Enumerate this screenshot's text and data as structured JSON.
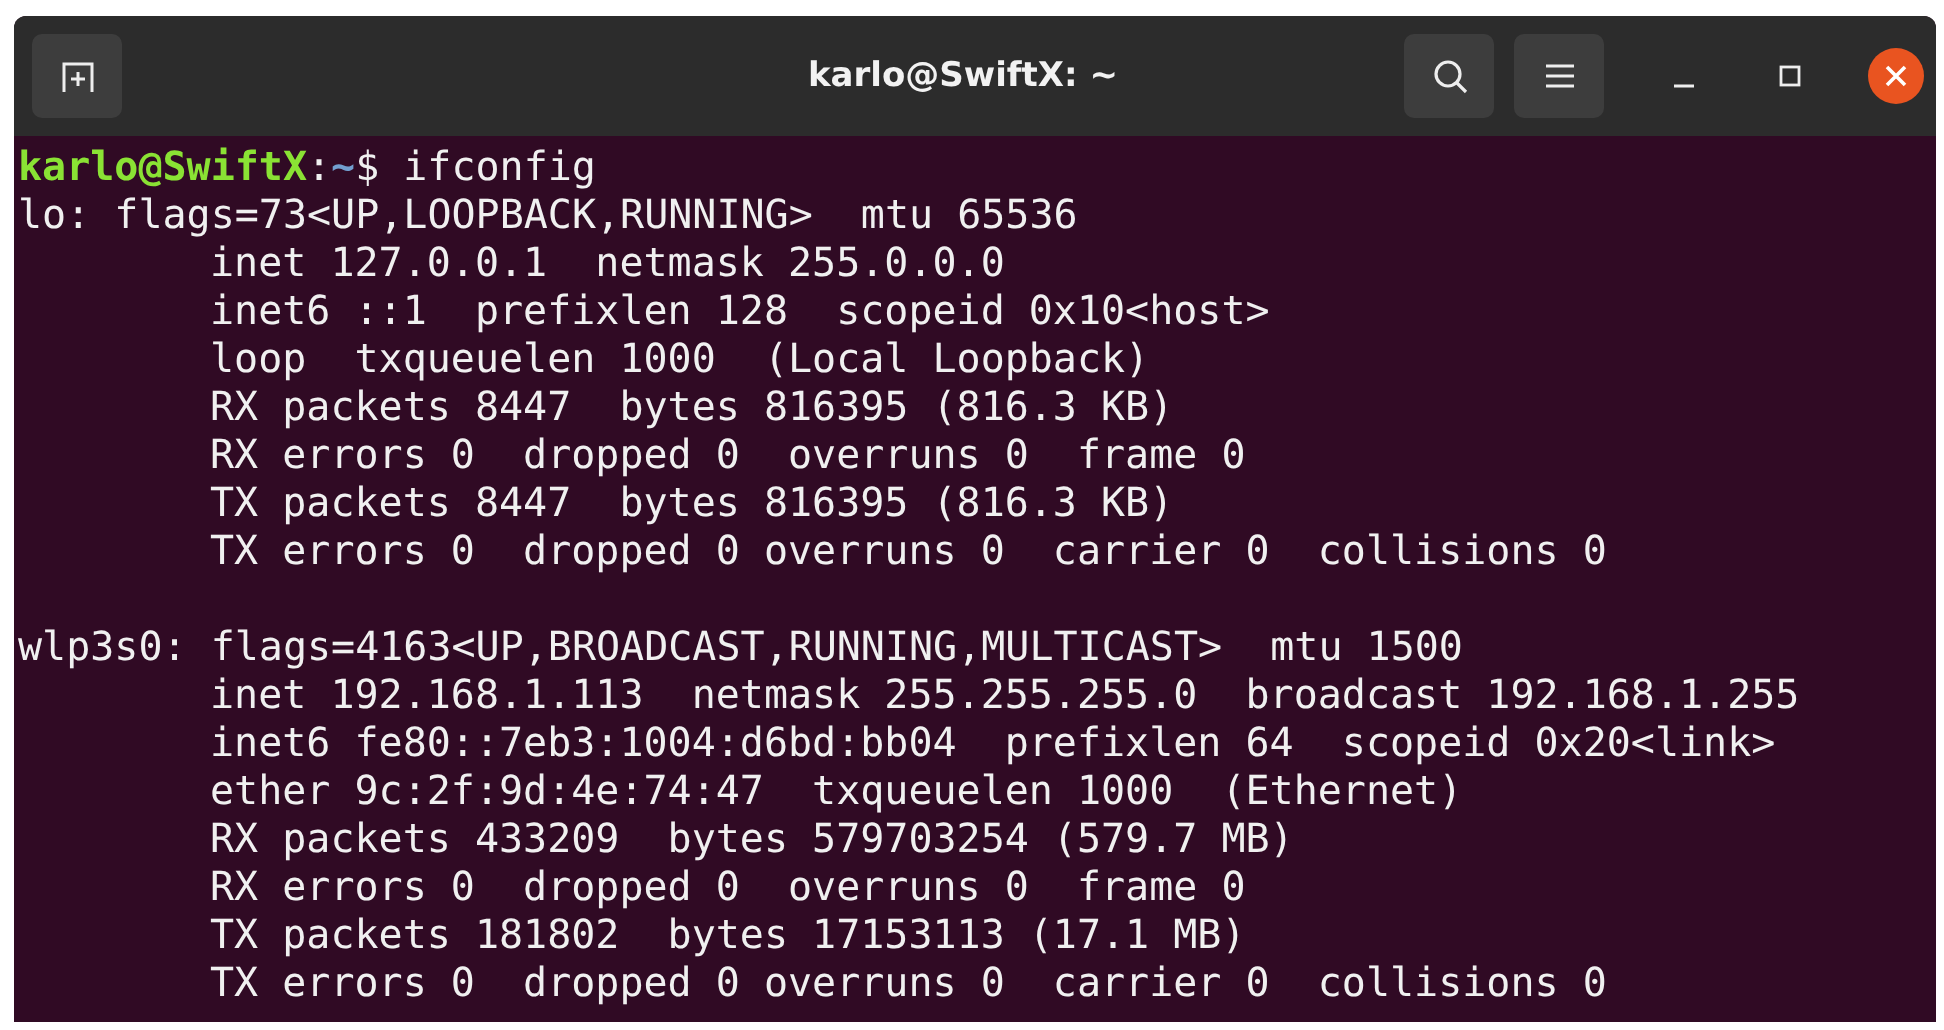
{
  "window": {
    "title": "karlo@SwiftX: ~"
  },
  "prompt": {
    "user_host": "karlo@SwiftX",
    "separator": ":",
    "path": "~",
    "symbol": "$",
    "command": "ifconfig"
  },
  "interfaces": [
    {
      "header": "lo: flags=73<UP,LOOPBACK,RUNNING>  mtu 65536",
      "lines": [
        "inet 127.0.0.1  netmask 255.0.0.0",
        "inet6 ::1  prefixlen 128  scopeid 0x10<host>",
        "loop  txqueuelen 1000  (Local Loopback)",
        "RX packets 8447  bytes 816395 (816.3 KB)",
        "RX errors 0  dropped 0  overruns 0  frame 0",
        "TX packets 8447  bytes 816395 (816.3 KB)",
        "TX errors 0  dropped 0 overruns 0  carrier 0  collisions 0"
      ]
    },
    {
      "header": "wlp3s0: flags=4163<UP,BROADCAST,RUNNING,MULTICAST>  mtu 1500",
      "lines": [
        "inet 192.168.1.113  netmask 255.255.255.0  broadcast 192.168.1.255",
        "inet6 fe80::7eb3:1004:d6bd:bb04  prefixlen 64  scopeid 0x20<link>",
        "ether 9c:2f:9d:4e:74:47  txqueuelen 1000  (Ethernet)",
        "RX packets 433209  bytes 579703254 (579.7 MB)",
        "RX errors 0  dropped 0  overruns 0  frame 0",
        "TX packets 181802  bytes 17153113 (17.1 MB)",
        "TX errors 0  dropped 0 overruns 0  carrier 0  collisions 0"
      ]
    }
  ]
}
